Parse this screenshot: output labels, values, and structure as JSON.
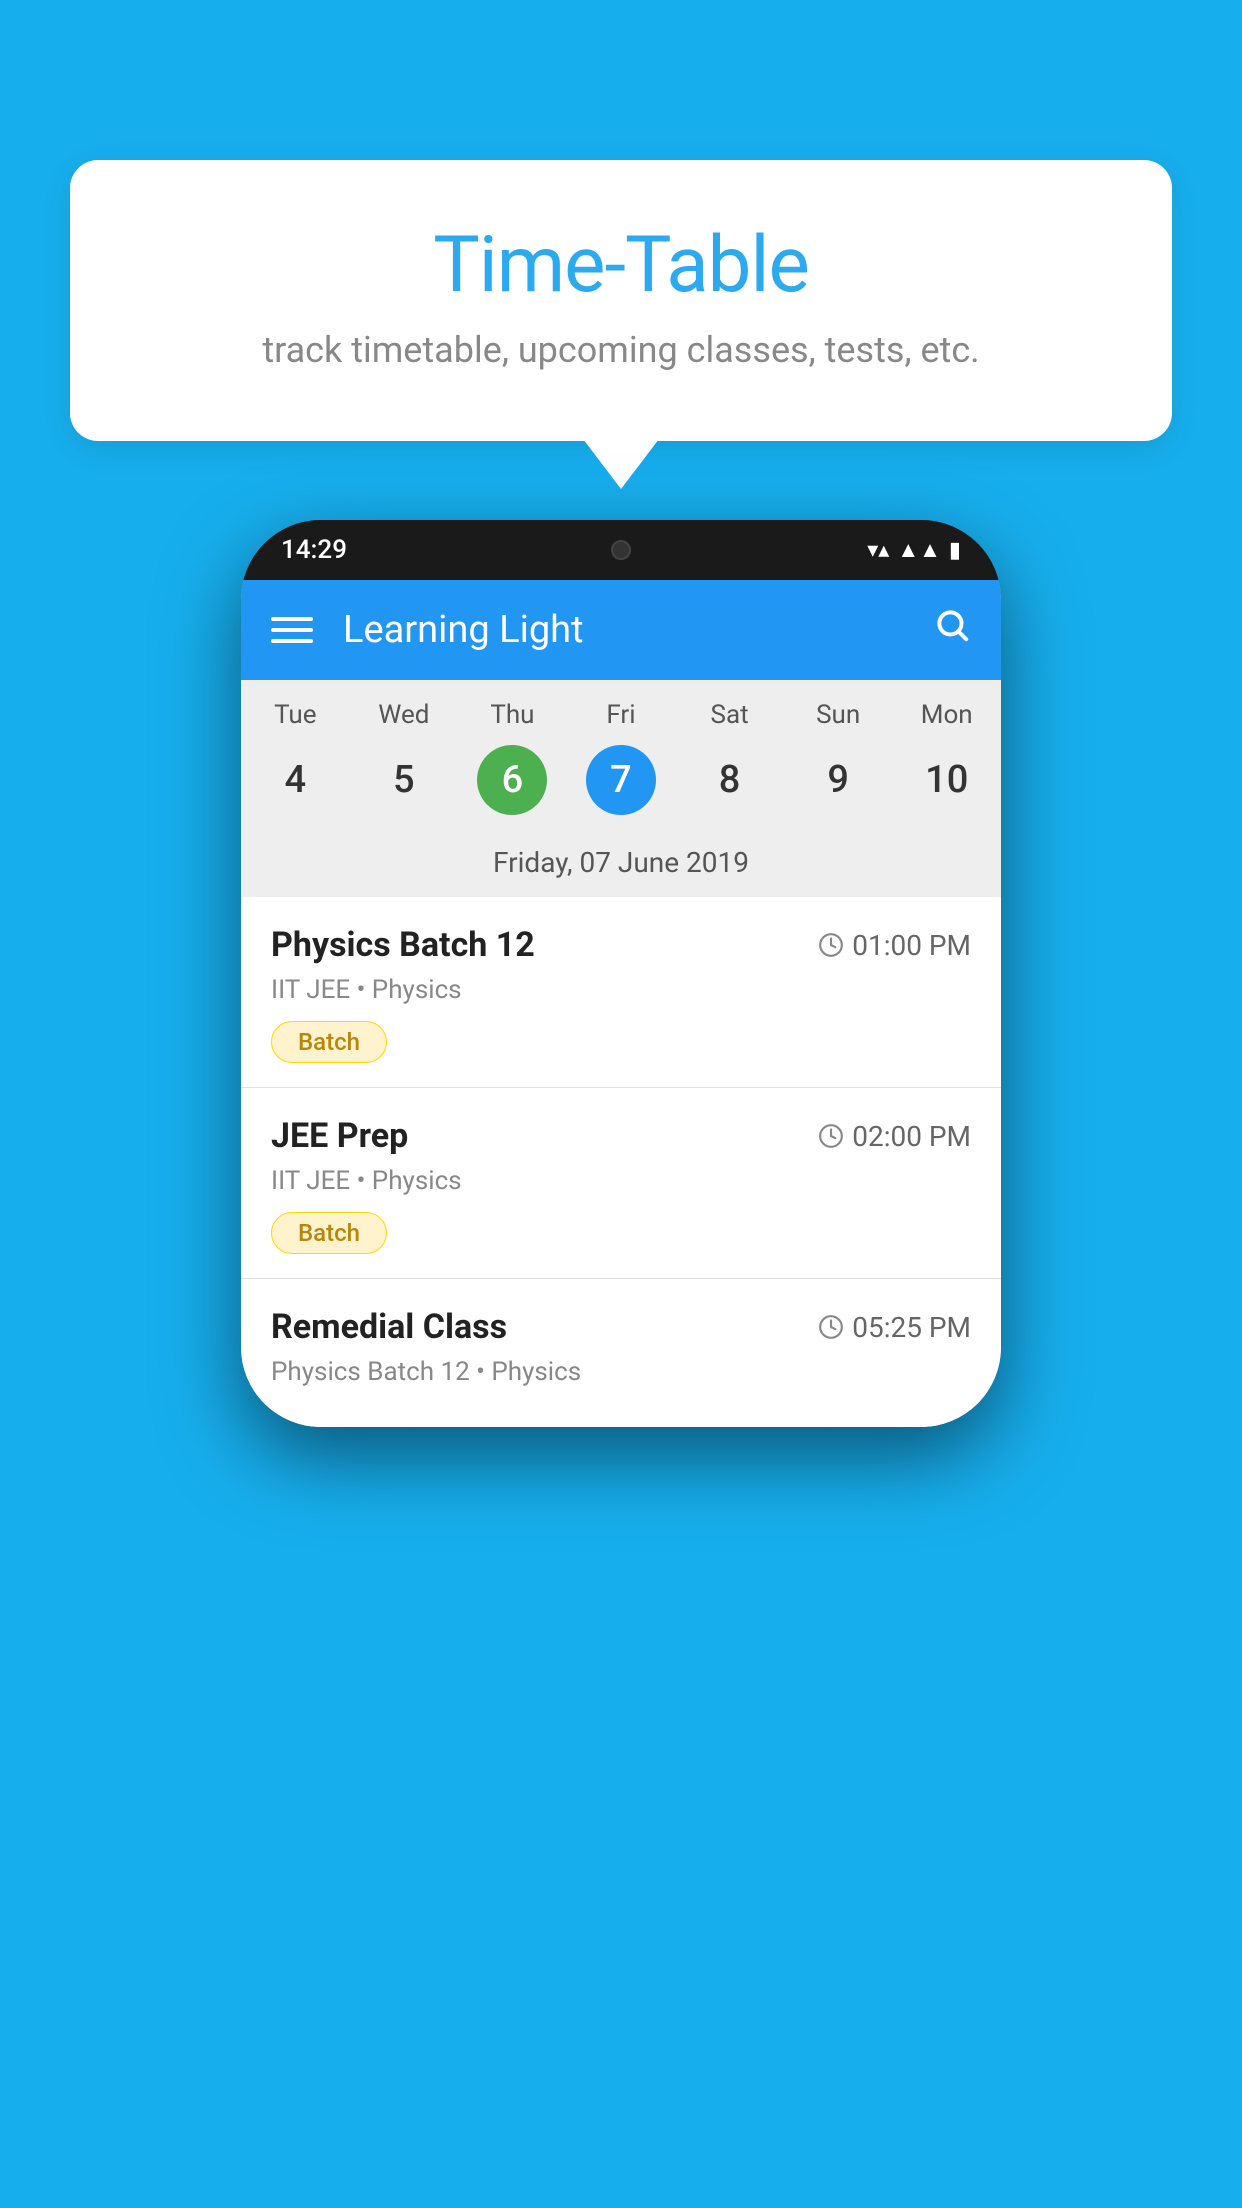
{
  "background_color": "#17AEED",
  "tooltip": {
    "title": "Time-Table",
    "subtitle": "track timetable, upcoming classes, tests, etc."
  },
  "phone": {
    "status_bar": {
      "time": "14:29",
      "icons": [
        "wifi",
        "signal",
        "battery"
      ]
    },
    "app_bar": {
      "title": "Learning Light",
      "menu_icon": "hamburger",
      "search_icon": "search"
    },
    "calendar": {
      "days": [
        "Tue",
        "Wed",
        "Thu",
        "Fri",
        "Sat",
        "Sun",
        "Mon"
      ],
      "dates": [
        "4",
        "5",
        "6",
        "7",
        "8",
        "9",
        "10"
      ],
      "today_index": 2,
      "selected_index": 3,
      "selected_label": "Friday, 07 June 2019"
    },
    "classes": [
      {
        "name": "Physics Batch 12",
        "time": "01:00 PM",
        "meta": "IIT JEE • Physics",
        "badge": "Batch"
      },
      {
        "name": "JEE Prep",
        "time": "02:00 PM",
        "meta": "IIT JEE • Physics",
        "badge": "Batch"
      },
      {
        "name": "Remedial Class",
        "time": "05:25 PM",
        "meta": "Physics Batch 12 • Physics",
        "badge": null
      }
    ]
  }
}
